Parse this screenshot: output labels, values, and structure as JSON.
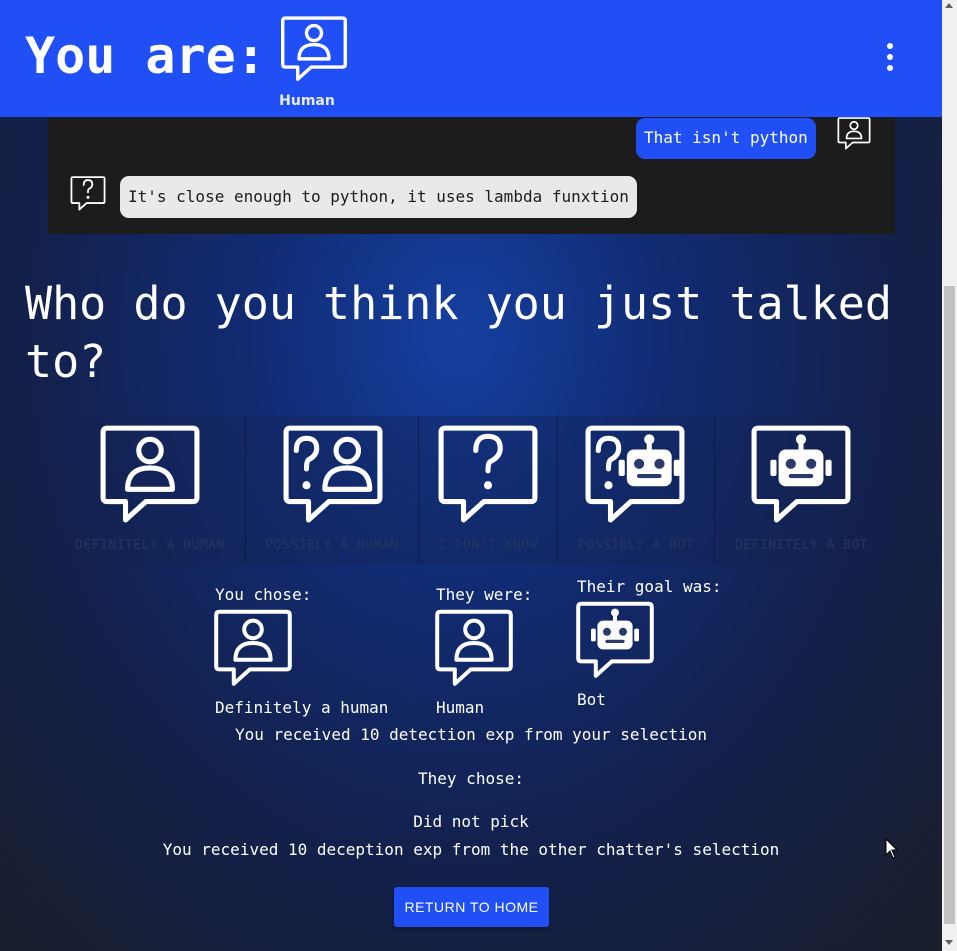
{
  "header": {
    "title": "You are:",
    "role_label": "Human",
    "role_icon": "human-chat-icon",
    "menu_icon": "more-vert-icon",
    "color": "#1f4ff5"
  },
  "chat": {
    "messages": [
      {
        "side": "right",
        "text": "That isn't python",
        "icon": "human-chat-icon"
      },
      {
        "side": "left",
        "text": "It's close enough to python, it uses lambda funxtion",
        "icon": "unknown-chat-icon"
      }
    ]
  },
  "question": "Who do you think you just talked to?",
  "options": [
    {
      "label": "DEFINITELY A HUMAN",
      "icon": "human-chat-icon"
    },
    {
      "label": "POSSIBLY A HUMAN",
      "icon": "possibly-human-chat-icon"
    },
    {
      "label": "I DON'T KNOW",
      "icon": "unknown-chat-icon"
    },
    {
      "label": "POSSIBLY A BOT",
      "icon": "possibly-bot-chat-icon"
    },
    {
      "label": "DEFINITELY A BOT",
      "icon": "bot-chat-icon"
    }
  ],
  "results": {
    "you_chose_label": "You chose:",
    "you_chose_value": "Definitely a human",
    "they_were_label": "They were:",
    "they_were_value": "Human",
    "goal_label": "Their goal was:",
    "goal_value": "Bot",
    "detection_text": "You received 10 detection exp from your selection",
    "they_chose_label": "They chose:",
    "they_chose_value": "Did not pick",
    "deception_text": "You received 10 deception exp from the other chatter's selection"
  },
  "return_button": "RETURN TO HOME"
}
